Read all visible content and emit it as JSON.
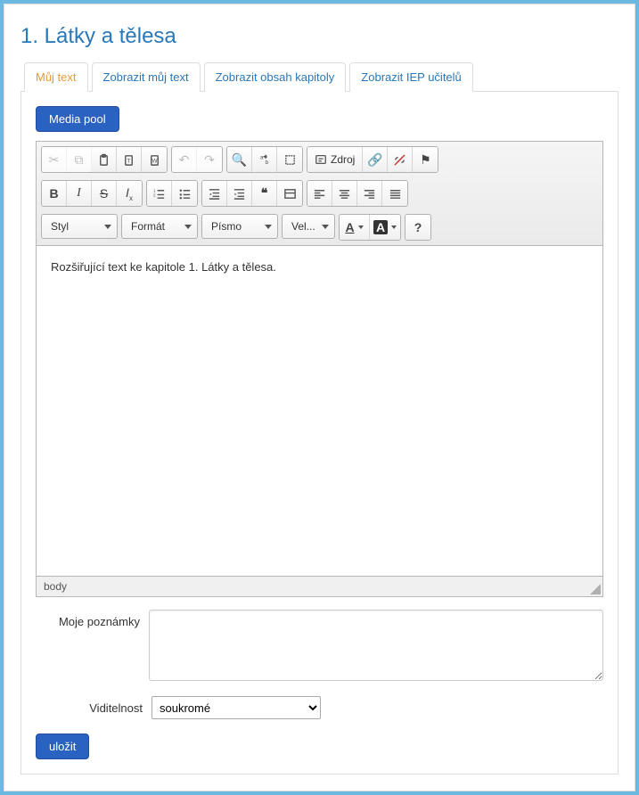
{
  "page": {
    "title": "1. Látky a tělesa"
  },
  "tabs": [
    {
      "label": "Můj text",
      "active": true
    },
    {
      "label": "Zobrazit můj text",
      "active": false
    },
    {
      "label": "Zobrazit obsah kapitoly",
      "active": false
    },
    {
      "label": "Zobrazit IEP učitelů",
      "active": false
    }
  ],
  "buttons": {
    "media_pool": "Media pool",
    "save": "uložit"
  },
  "editor": {
    "content": "Rozšiřující text ke kapitole 1. Látky a tělesa.",
    "status_path": "body",
    "source_label": "Zdroj",
    "combos": {
      "style": "Styl",
      "format": "Formát",
      "font": "Písmo",
      "size": "Vel...",
      "textcolor": "A",
      "bgcolor": "A",
      "help": "?"
    }
  },
  "form": {
    "notes_label": "Moje poznámky",
    "notes_value": "",
    "visibility_label": "Viditelnost",
    "visibility_value": "soukromé",
    "visibility_options": [
      "soukromé"
    ]
  }
}
